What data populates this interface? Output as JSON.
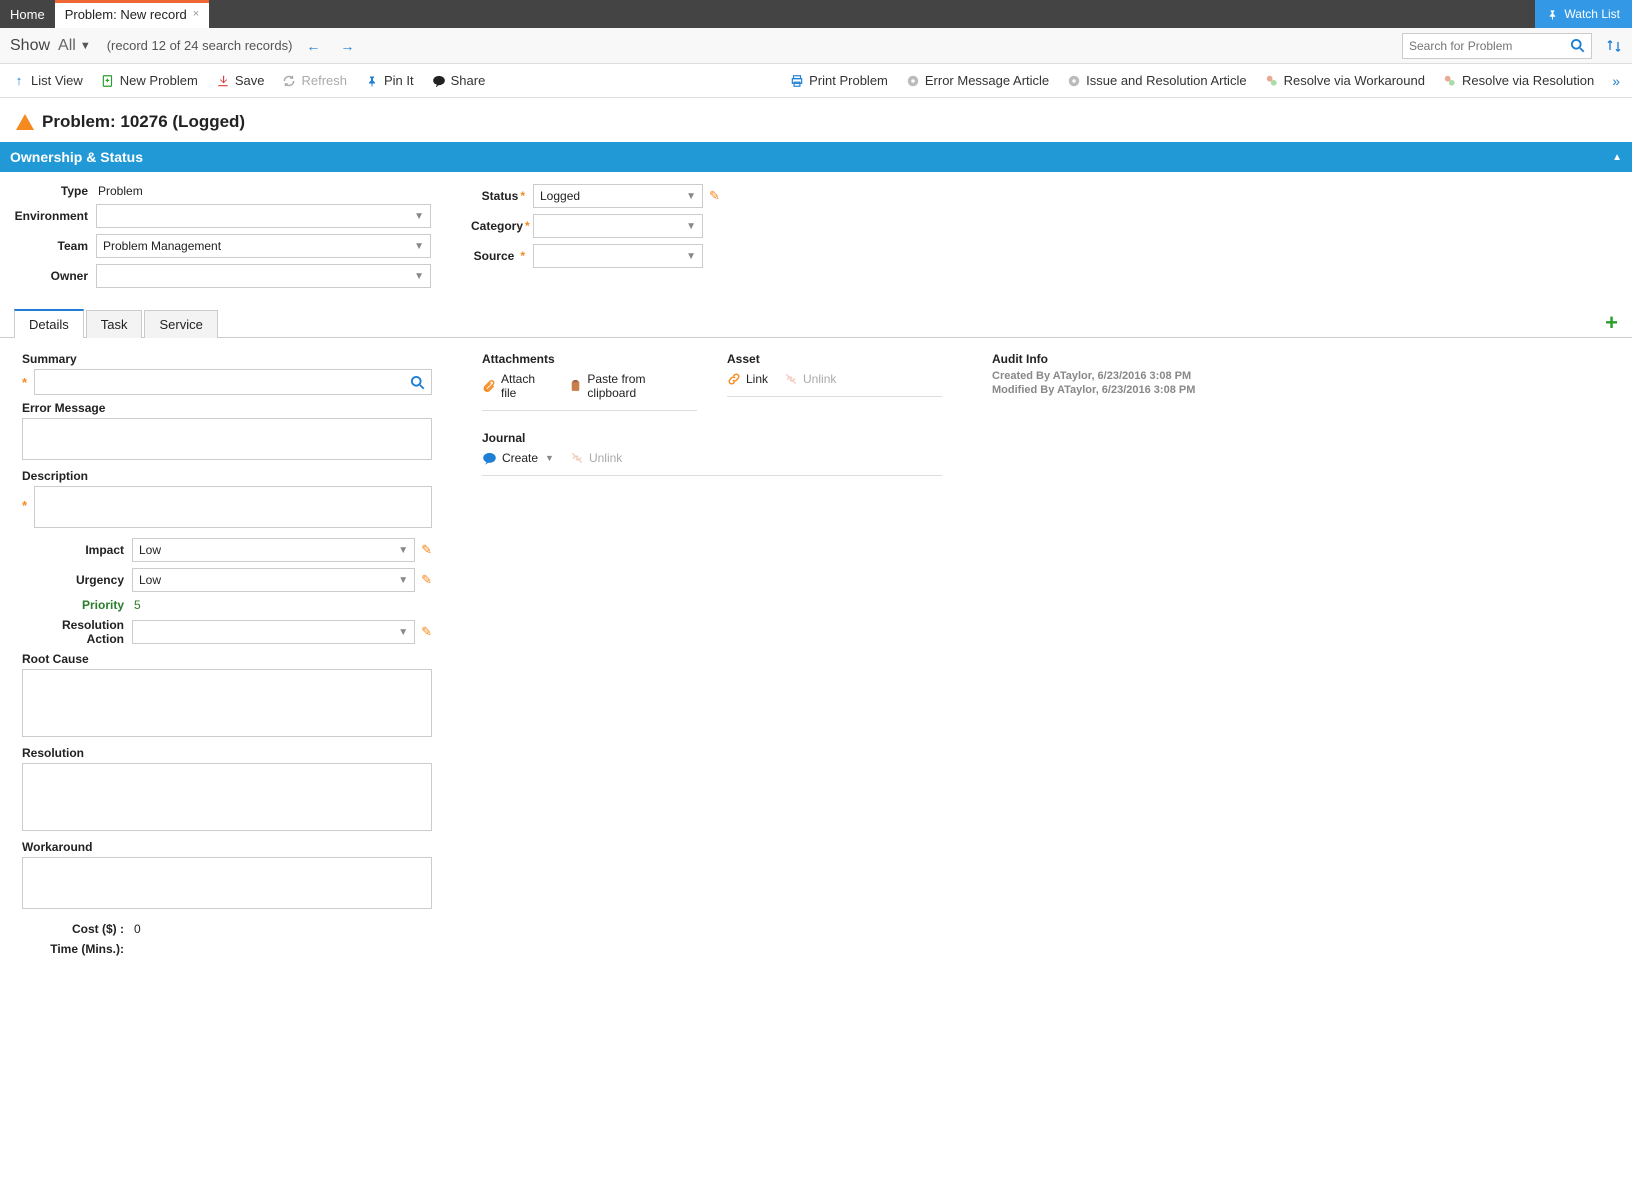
{
  "topTabs": {
    "home": "Home",
    "record": "Problem: New record"
  },
  "watchList": "Watch List",
  "showBar": {
    "show": "Show",
    "all": "All",
    "recordNav": "(record 12 of 24 search records)",
    "searchPlaceholder": "Search for Problem"
  },
  "toolbar": {
    "listView": "List View",
    "newProblem": "New Problem",
    "save": "Save",
    "refresh": "Refresh",
    "pinIt": "Pin It",
    "share": "Share",
    "printProblem": "Print Problem",
    "errorArticle": "Error Message Article",
    "issueArticle": "Issue and Resolution Article",
    "resolveWorkaround": "Resolve via Workaround",
    "resolveResolution": "Resolve via Resolution"
  },
  "pageTitle": "Problem: 10276 (Logged)",
  "sectionHeader": "Ownership & Status",
  "ownership": {
    "labels": {
      "type": "Type",
      "environment": "Environment",
      "team": "Team",
      "owner": "Owner",
      "status": "Status",
      "category": "Category",
      "source": "Source"
    },
    "type": "Problem",
    "environment": "",
    "team": "Problem Management",
    "owner": "",
    "status": "Logged",
    "category": "",
    "source": ""
  },
  "tabs": {
    "details": "Details",
    "task": "Task",
    "service": "Service"
  },
  "details": {
    "labels": {
      "summary": "Summary",
      "errorMessage": "Error Message",
      "description": "Description",
      "impact": "Impact",
      "urgency": "Urgency",
      "priority": "Priority",
      "resolutionAction": "Resolution Action",
      "rootCause": "Root Cause",
      "resolution": "Resolution",
      "workaround": "Workaround",
      "cost": "Cost ($) :",
      "time": "Time (Mins.):"
    },
    "impact": "Low",
    "urgency": "Low",
    "priority": "5",
    "cost": "0",
    "time": ""
  },
  "panels": {
    "attachments": {
      "title": "Attachments",
      "attachFile": "Attach file",
      "pasteClipboard": "Paste from clipboard"
    },
    "asset": {
      "title": "Asset",
      "link": "Link",
      "unlink": "Unlink"
    },
    "journal": {
      "title": "Journal",
      "create": "Create",
      "unlink": "Unlink"
    }
  },
  "audit": {
    "title": "Audit Info",
    "created": "Created By ATaylor, 6/23/2016 3:08 PM",
    "modified": "Modified By ATaylor, 6/23/2016 3:08 PM"
  }
}
